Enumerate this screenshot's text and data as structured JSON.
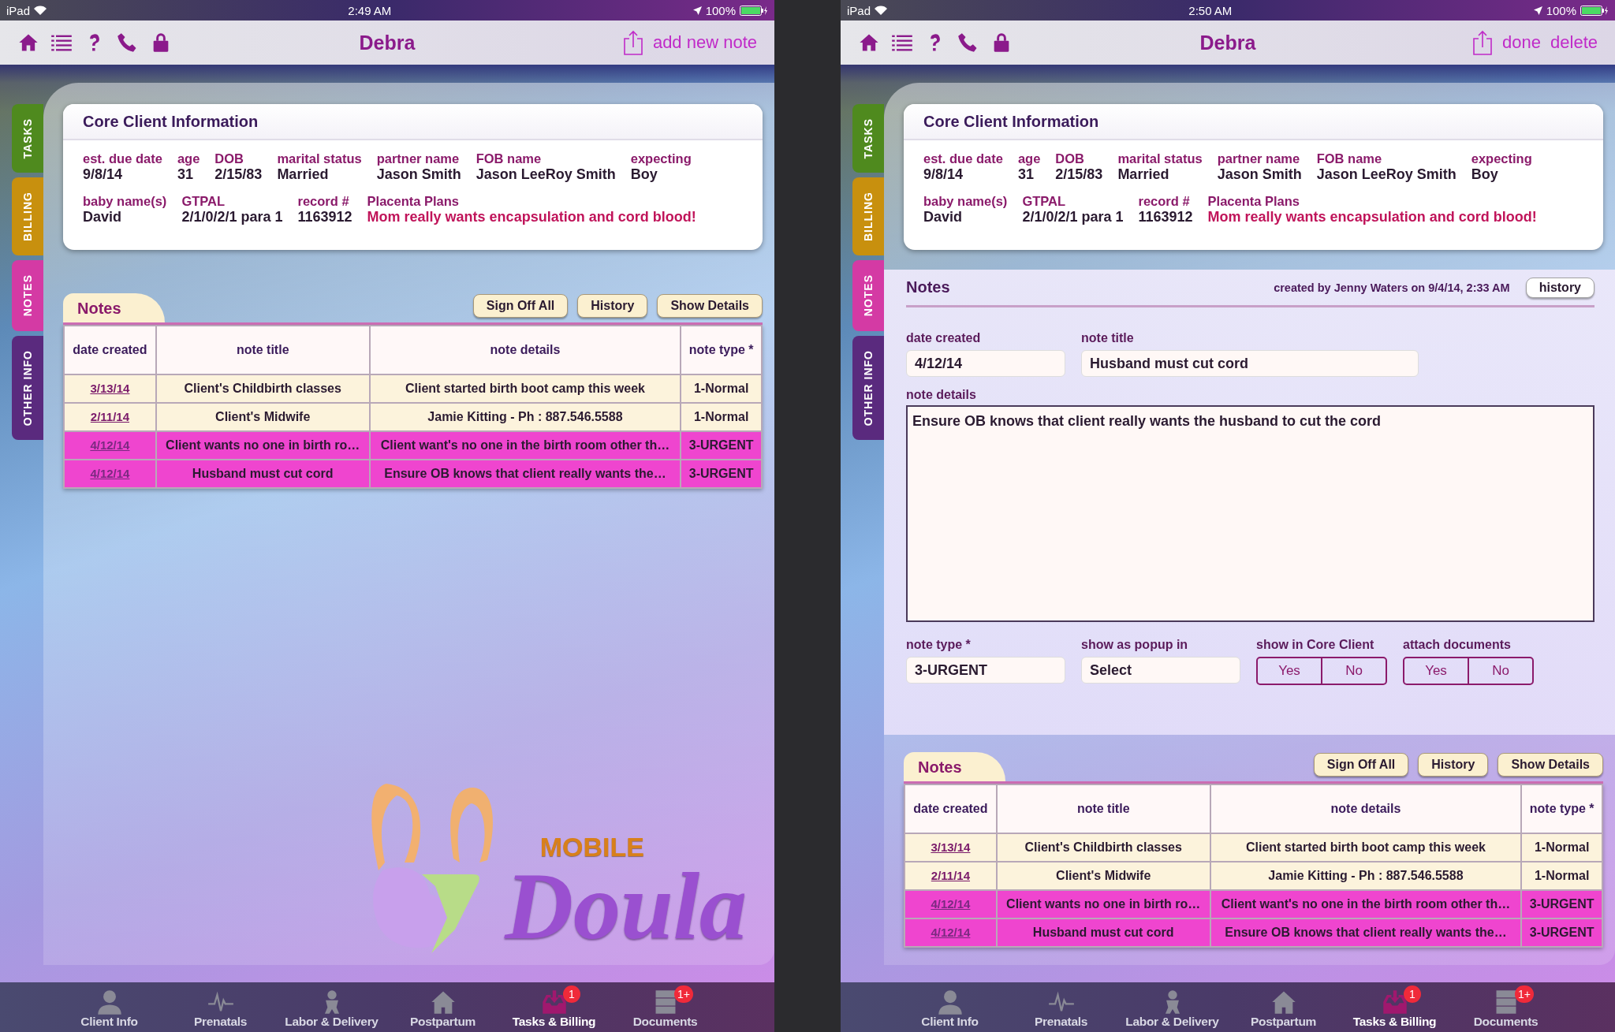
{
  "screens": [
    {
      "status_bar": {
        "carrier": "iPad",
        "time": "2:49 AM",
        "battery": "100%"
      },
      "nav": {
        "title": "Debra",
        "actions": [
          "add new note"
        ]
      },
      "side_tabs": [
        {
          "label": "TASKS",
          "color": "#4f8a1e"
        },
        {
          "label": "BILLING",
          "color": "#c8900e"
        },
        {
          "label": "NOTES",
          "color": "#d43aa4"
        },
        {
          "label": "OTHER INFO",
          "color": "#5a2a7e"
        }
      ],
      "core_info": {
        "title": "Core Client Information",
        "first_line": [
          {
            "label": "est. due date",
            "value": "9/8/14",
            "emphasis": false
          },
          {
            "label": "age",
            "value": "31",
            "emphasis": false
          },
          {
            "label": "DOB",
            "value": "2/15/83",
            "emphasis": false
          },
          {
            "label": "marital status",
            "value": "Married",
            "emphasis": false
          },
          {
            "label": "partner name",
            "value": "Jason Smith",
            "emphasis": false
          },
          {
            "label": "FOB name",
            "value": "Jason LeeRoy Smith",
            "emphasis": false
          },
          {
            "label": "expecting",
            "value": "Boy",
            "emphasis": false
          }
        ],
        "second_line": [
          {
            "label": "baby name(s)",
            "value": "David",
            "emphasis": false
          },
          {
            "label": "GTPAL",
            "value": "2/1/0/2/1 para 1",
            "emphasis": false
          },
          {
            "label": "record #",
            "value": "1163912",
            "emphasis": false
          },
          {
            "label": "Placenta Plans",
            "value": "Mom really wants encapsulation and cord blood!",
            "emphasis": true
          }
        ]
      },
      "notes": {
        "title": "Notes",
        "buttons": [
          "Sign Off All",
          "History",
          "Show Details"
        ],
        "columns": [
          "date created",
          "note title",
          "note details",
          "note type *"
        ],
        "rows": [
          {
            "date": "3/13/14",
            "title": "Client's Childbirth classes",
            "details": "Client started birth boot camp this week",
            "type": "1-Normal",
            "urgent": false
          },
          {
            "date": "2/11/14",
            "title": "Client's Midwife",
            "details": "Jamie Kitting - Ph : 887.546.5588",
            "type": "1-Normal",
            "urgent": false
          },
          {
            "date": "4/12/14",
            "title": "Client wants no one in birth ro…",
            "details": "Client want's no one in the birth room other th…",
            "type": "3-URGENT",
            "urgent": true
          },
          {
            "date": "4/12/14",
            "title": "Husband must cut cord",
            "details": "Ensure OB knows that client really wants the…",
            "type": "3-URGENT",
            "urgent": true
          }
        ]
      },
      "logo": {
        "small": "MOBILE",
        "large": "Doula"
      },
      "tab_bar": [
        {
          "label": "Client Info",
          "selected": false
        },
        {
          "label": "Prenatals",
          "selected": false
        },
        {
          "label": "Labor & Delivery",
          "selected": false
        },
        {
          "label": "Postpartum",
          "selected": false
        },
        {
          "label": "Tasks & Billing",
          "selected": true,
          "badge": "1"
        },
        {
          "label": "Documents",
          "selected": false,
          "badge": "1+"
        }
      ]
    },
    {
      "status_bar": {
        "carrier": "iPad",
        "time": "2:50 AM",
        "battery": "100%"
      },
      "nav": {
        "title": "Debra",
        "actions": [
          "done",
          "delete"
        ]
      },
      "side_tabs": [
        {
          "label": "TASKS",
          "color": "#4f8a1e"
        },
        {
          "label": "BILLING",
          "color": "#c8900e"
        },
        {
          "label": "NOTES",
          "color": "#d43aa4"
        },
        {
          "label": "OTHER INFO",
          "color": "#5a2a7e"
        }
      ],
      "core_info": {
        "title": "Core Client Information",
        "first_line": [
          {
            "label": "est. due date",
            "value": "9/8/14",
            "emphasis": false
          },
          {
            "label": "age",
            "value": "31",
            "emphasis": false
          },
          {
            "label": "DOB",
            "value": "2/15/83",
            "emphasis": false
          },
          {
            "label": "marital status",
            "value": "Married",
            "emphasis": false
          },
          {
            "label": "partner name",
            "value": "Jason Smith",
            "emphasis": false
          },
          {
            "label": "FOB name",
            "value": "Jason LeeRoy Smith",
            "emphasis": false
          },
          {
            "label": "expecting",
            "value": "Boy",
            "emphasis": false
          }
        ],
        "second_line": [
          {
            "label": "baby name(s)",
            "value": "David",
            "emphasis": false
          },
          {
            "label": "GTPAL",
            "value": "2/1/0/2/1 para 1",
            "emphasis": false
          },
          {
            "label": "record #",
            "value": "1163912",
            "emphasis": false
          },
          {
            "label": "Placenta Plans",
            "value": "Mom really wants encapsulation and cord blood!",
            "emphasis": true
          }
        ]
      },
      "note_editor": {
        "title": "Notes",
        "created": "created by Jenny Waters on 9/4/14, 2:33 AM",
        "history_button": "history",
        "date_label": "date created",
        "date_value": "4/12/14",
        "title_label": "note title",
        "title_value": "Husband must cut cord",
        "details_label": "note details",
        "details_value": "Ensure OB knows that client really wants the husband to cut the cord",
        "type_label": "note type *",
        "type_value": "3-URGENT",
        "popup_label": "show as popup in",
        "popup_value": "Select",
        "toggles": [
          {
            "label": "show in Core Client",
            "options": [
              "Yes",
              "No"
            ]
          },
          {
            "label": "attach documents",
            "options": [
              "Yes",
              "No"
            ]
          }
        ]
      },
      "notes": {
        "title": "Notes",
        "buttons": [
          "Sign Off All",
          "History",
          "Show Details"
        ],
        "columns": [
          "date created",
          "note title",
          "note details",
          "note type *"
        ],
        "rows": [
          {
            "date": "3/13/14",
            "title": "Client's Childbirth classes",
            "details": "Client started birth boot camp this week",
            "type": "1-Normal",
            "urgent": false
          },
          {
            "date": "2/11/14",
            "title": "Client's Midwife",
            "details": "Jamie Kitting - Ph : 887.546.5588",
            "type": "1-Normal",
            "urgent": false
          },
          {
            "date": "4/12/14",
            "title": "Client wants no one in birth ro…",
            "details": "Client want's no one in the birth room other th…",
            "type": "3-URGENT",
            "urgent": true
          },
          {
            "date": "4/12/14",
            "title": "Husband must cut cord",
            "details": "Ensure OB knows that client really wants the…",
            "type": "3-URGENT",
            "urgent": true
          }
        ]
      },
      "tab_bar": [
        {
          "label": "Client Info",
          "selected": false
        },
        {
          "label": "Prenatals",
          "selected": false
        },
        {
          "label": "Labor & Delivery",
          "selected": false
        },
        {
          "label": "Postpartum",
          "selected": false
        },
        {
          "label": "Tasks & Billing",
          "selected": true,
          "badge": "1"
        },
        {
          "label": "Documents",
          "selected": false,
          "badge": "1+"
        }
      ]
    }
  ]
}
